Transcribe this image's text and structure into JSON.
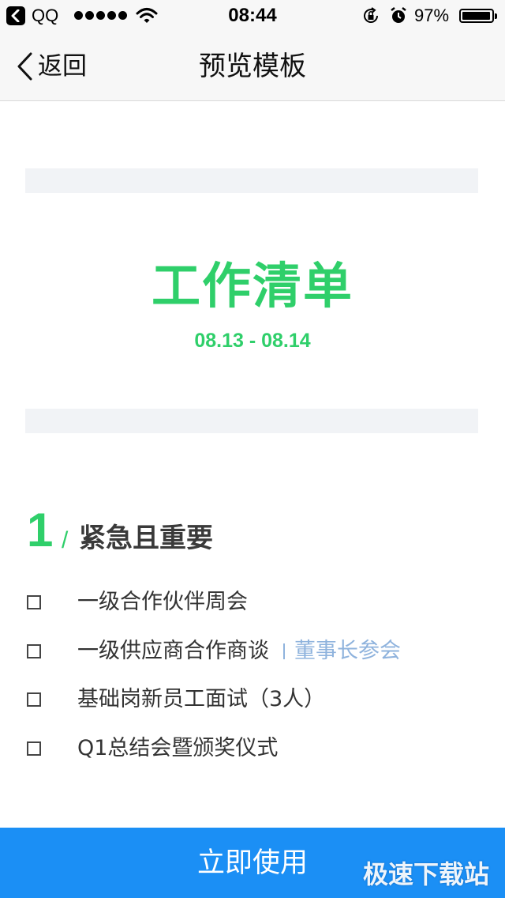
{
  "status_bar": {
    "app_label": "QQ",
    "time": "08:44",
    "battery_percent": "97%",
    "battery_level": 0.97,
    "signal_dots": 5,
    "icons": [
      "back-to-app-icon",
      "signal-dots-icon",
      "wifi-icon",
      "orientation-lock-icon",
      "alarm-icon",
      "battery-icon"
    ]
  },
  "nav": {
    "back_label": "返回",
    "title": "预览模板"
  },
  "document": {
    "title": "工作清单",
    "date_range": "08.13 - 08.14",
    "section": {
      "number": "1",
      "slash": "/",
      "title": "紧急且重要",
      "tasks": [
        {
          "label": "一级合作伙伴周会",
          "note": ""
        },
        {
          "label": "一级供应商合作商谈",
          "note": "董事长参会"
        },
        {
          "label": "基础岗新员工面试（3人）",
          "note": ""
        },
        {
          "label": "Q1总结会暨颁奖仪式",
          "note": ""
        }
      ]
    }
  },
  "action": {
    "use_now_label": "立即使用"
  },
  "watermark": "极速下载站",
  "colors": {
    "accent_green": "#2fcf6a",
    "button_blue": "#1b8ff5",
    "note_blue": "#8fb3dd",
    "band_gray": "#f1f3f6"
  }
}
